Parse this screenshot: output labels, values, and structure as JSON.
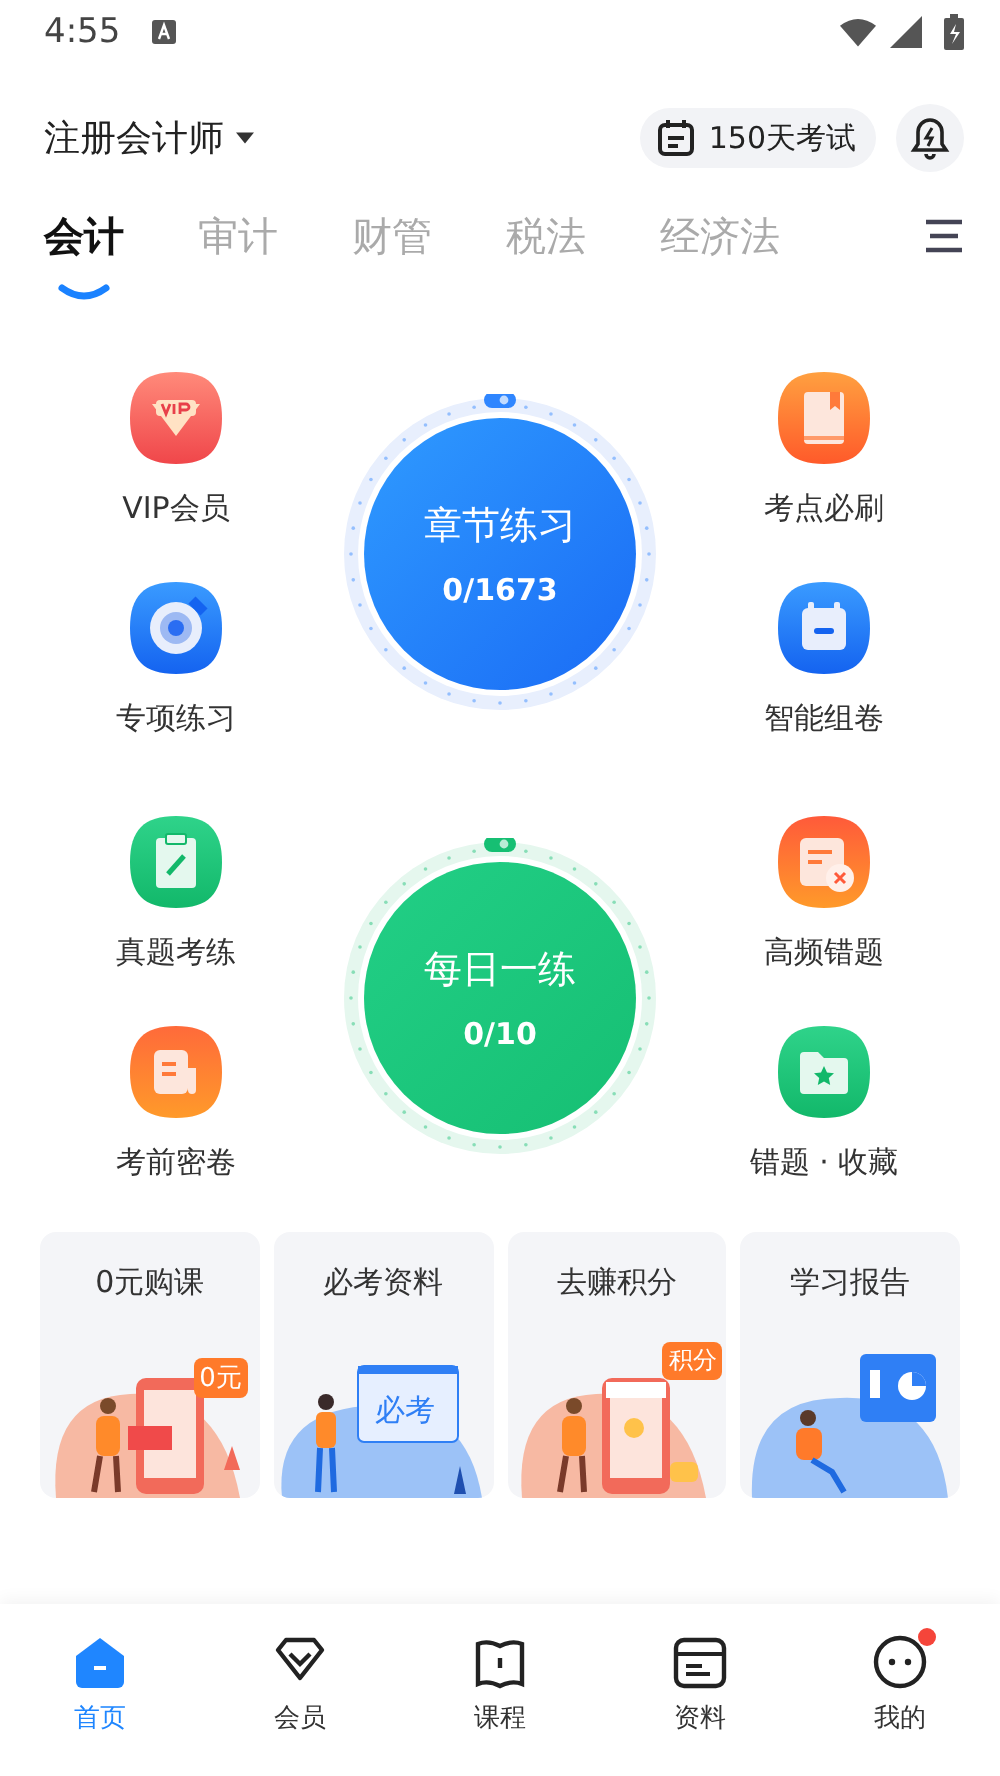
{
  "status_bar": {
    "time": "4:55"
  },
  "header": {
    "exam_title": "注册会计师",
    "countdown": "150天考试"
  },
  "tabs": [
    {
      "label": "会计",
      "selected": true
    },
    {
      "label": "审计",
      "selected": false
    },
    {
      "label": "财管",
      "selected": false
    },
    {
      "label": "税法",
      "selected": false
    },
    {
      "label": "经济法",
      "selected": false
    }
  ],
  "sections": [
    {
      "kind": "chapter",
      "title": "章节练习",
      "progress": "0/1673",
      "left": [
        {
          "label": "VIP会员",
          "kind": "vip"
        },
        {
          "label": "专项练习",
          "kind": "target"
        }
      ],
      "right": [
        {
          "label": "考点必刷",
          "kind": "book"
        },
        {
          "label": "智能组卷",
          "kind": "calendar"
        }
      ]
    },
    {
      "kind": "daily",
      "title": "每日一练",
      "progress": "0/10",
      "left": [
        {
          "label": "真题考练",
          "kind": "clipboard"
        },
        {
          "label": "考前密卷",
          "kind": "document"
        }
      ],
      "right": [
        {
          "label": "高频错题",
          "kind": "error-sheet"
        },
        {
          "label": "错题 · 收藏",
          "kind": "folder"
        }
      ]
    }
  ],
  "cards": [
    {
      "title": "0元购课",
      "badge": "0元",
      "kind": "phone"
    },
    {
      "title": "必考资料",
      "badge": "必考",
      "kind": "board"
    },
    {
      "title": "去赚积分",
      "badge": "积分",
      "kind": "shop"
    },
    {
      "title": "学习报告",
      "kind": "report"
    }
  ],
  "bottom_nav": [
    {
      "label": "首页",
      "kind": "home",
      "selected": true,
      "notification": false
    },
    {
      "label": "会员",
      "kind": "diamond",
      "selected": false,
      "notification": false
    },
    {
      "label": "课程",
      "kind": "book",
      "selected": false,
      "notification": false
    },
    {
      "label": "资料",
      "kind": "card",
      "selected": false,
      "notification": false
    },
    {
      "label": "我的",
      "kind": "face",
      "selected": false,
      "notification": true
    }
  ]
}
